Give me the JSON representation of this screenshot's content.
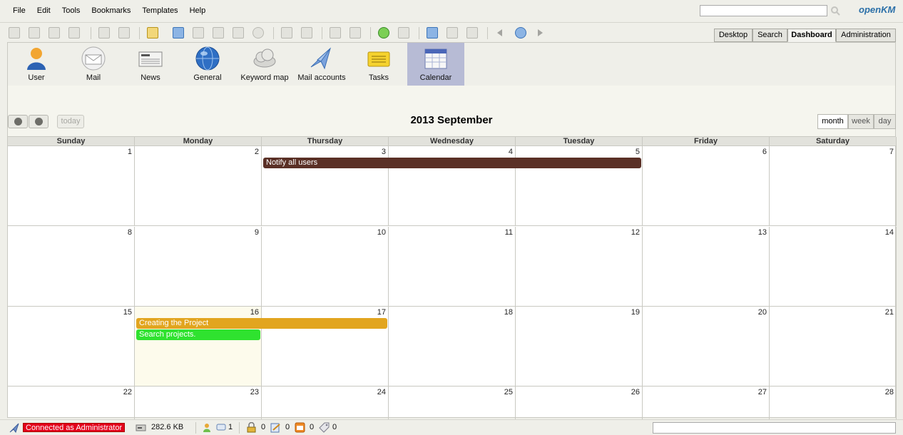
{
  "menu": {
    "items": [
      "File",
      "Edit",
      "Tools",
      "Bookmarks",
      "Templates",
      "Help"
    ]
  },
  "logo": {
    "main": "penKM",
    "prefix": "o"
  },
  "tabs": {
    "desktop": "Desktop",
    "search": "Search",
    "dashboard": "Dashboard",
    "administration": "Administration"
  },
  "dashboard": {
    "items": [
      {
        "label": "User",
        "icon": "user-icon"
      },
      {
        "label": "Mail",
        "icon": "mail-icon"
      },
      {
        "label": "News",
        "icon": "news-icon"
      },
      {
        "label": "General",
        "icon": "globe-icon"
      },
      {
        "label": "Keyword map",
        "icon": "cloud-icon"
      },
      {
        "label": "Mail accounts",
        "icon": "mail-accounts-icon"
      },
      {
        "label": "Tasks",
        "icon": "tasks-icon"
      },
      {
        "label": "Calendar",
        "icon": "calendar-icon"
      }
    ],
    "active": "Calendar"
  },
  "calendar": {
    "title": "2013 September",
    "today_label": "today",
    "views": {
      "month": "month",
      "week": "week",
      "day": "day",
      "active": "month"
    },
    "day_headers": [
      "Sunday",
      "Monday",
      "Thursday",
      "Wednesday",
      "Tuesday",
      "Friday",
      "Saturday"
    ],
    "weeks": [
      [
        1,
        2,
        3,
        4,
        5,
        6,
        7
      ],
      [
        8,
        9,
        10,
        11,
        12,
        13,
        14
      ],
      [
        15,
        16,
        17,
        18,
        19,
        20,
        21
      ],
      [
        22,
        23,
        24,
        25,
        26,
        27,
        28
      ]
    ],
    "today_day": 16,
    "events": [
      {
        "title": "Notify all users",
        "color": "#5a3026"
      },
      {
        "title": "Creating the Project",
        "color": "#e2a51f"
      },
      {
        "title": "Search projects.",
        "color": "#2fe22f"
      }
    ]
  },
  "status": {
    "connected": "Connected as Administrator",
    "size": "282.6 KB",
    "users_count": "1",
    "locked_count": "0",
    "checkout_count": "0",
    "mail_count": "0",
    "tag_count": "0"
  }
}
